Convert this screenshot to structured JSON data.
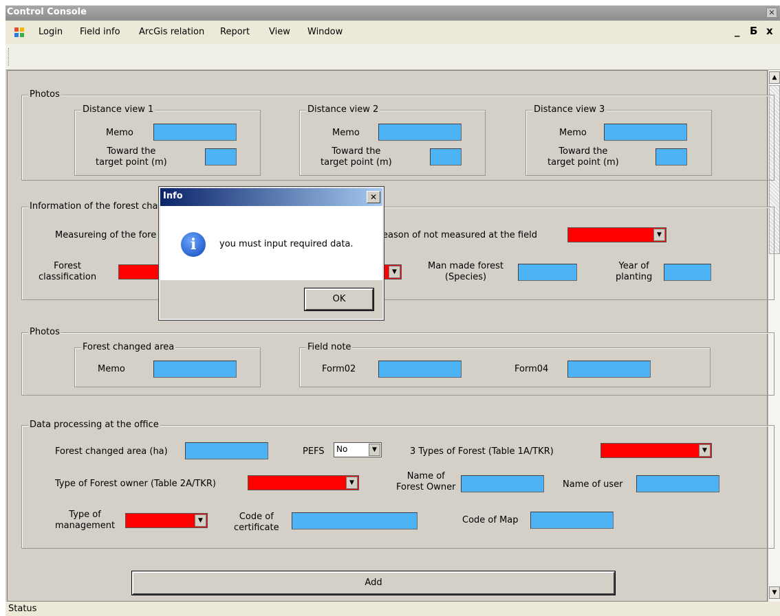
{
  "window": {
    "title": "Control Console",
    "status": "Status"
  },
  "menu": [
    "Login",
    "Field info",
    "ArcGis relation",
    "Report",
    "View",
    "Window"
  ],
  "window_controls": {
    "minimize": "_",
    "restore": "Б",
    "close": "x"
  },
  "photos1": {
    "title": "Photos",
    "views": [
      {
        "title": "Distance view 1",
        "memo": "Memo",
        "toward": "Toward the\ntarget point (m)"
      },
      {
        "title": "Distance view 2",
        "memo": "Memo",
        "toward": "Toward the\ntarget point (m)"
      },
      {
        "title": "Distance view 3",
        "memo": "Memo",
        "toward": "Toward the\ntarget point (m)"
      }
    ]
  },
  "forest_info": {
    "title": "Information of the forest cha",
    "measuring": "Measureing of the fore",
    "reason": "eason of not measured at the field",
    "classification": "Forest\nclassification",
    "man_made": "Man made forest\n(Species)",
    "year": "Year of\nplanting"
  },
  "photos2": {
    "title": "Photos",
    "changed_area": {
      "title": "Forest changed area",
      "memo": "Memo"
    },
    "field_note": {
      "title": "Field note",
      "form02": "Form02",
      "form04": "Form04"
    }
  },
  "office": {
    "title": "Data processing at the office",
    "changed_area_ha": "Forest changed area (ha)",
    "pefs": "PEFS",
    "pefs_value": "No",
    "types_forest": "3 Types of Forest (Table 1A/TKR)",
    "owner_type": "Type of Forest owner (Table 2A/TKR)",
    "owner_name": "Name of\nForest Owner",
    "user_name": "Name of user",
    "management": "Type of\nmanagement",
    "certificate": "Code of\ncertificate",
    "map_code": "Code of Map"
  },
  "add_label": "Add",
  "dialog": {
    "title": "Info",
    "message": "you must input required data.",
    "ok": "OK",
    "close": "✕",
    "icon_glyph": "i"
  },
  "colors": {
    "input_blue": "#4db3f5",
    "required_red": "#ff0000",
    "face": "#d4d0c8"
  }
}
